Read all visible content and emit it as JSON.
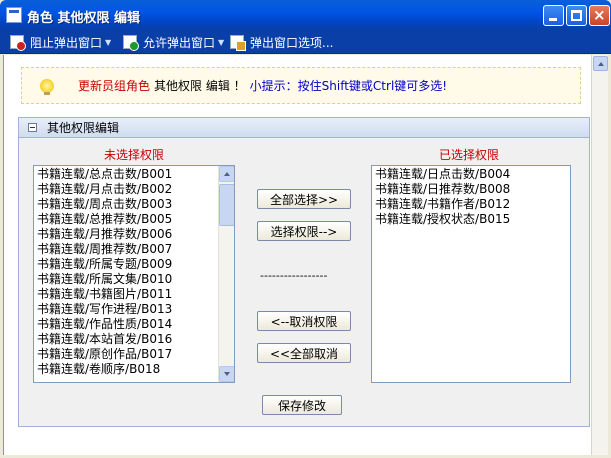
{
  "window": {
    "title": "角色 其他权限 编辑"
  },
  "toolbar": {
    "block_popup": "阻止弹出窗口",
    "allow_popup": "允许弹出窗口",
    "popup_options": "弹出窗口选项..."
  },
  "tip": {
    "role": "更新员组角色",
    "middle": "其他权限 编辑 ！",
    "hint": "小提示：按住Shift键或Ctrl键可多选!"
  },
  "panel": {
    "title": "其他权限编辑",
    "unselected_label": "未选择权限",
    "selected_label": "已选择权限"
  },
  "unselected": [
    "书籍连载/总点击数/B001",
    "书籍连载/月点击数/B002",
    "书籍连载/周点击数/B003",
    "书籍连载/总推荐数/B005",
    "书籍连载/月推荐数/B006",
    "书籍连载/周推荐数/B007",
    "书籍连载/所属专题/B009",
    "书籍连载/所属文集/B010",
    "书籍连载/书籍图片/B011",
    "书籍连载/写作进程/B013",
    "书籍连载/作品性质/B014",
    "书籍连载/本站首发/B016",
    "书籍连载/原创作品/B017",
    "书籍连载/卷顺序/B018"
  ],
  "selected": [
    "书籍连载/日点击数/B004",
    "书籍连载/日推荐数/B008",
    "书籍连载/书籍作者/B012",
    "书籍连载/授权状态/B015"
  ],
  "buttons": {
    "select_all": "全部选择>>",
    "select": "选择权限-->",
    "separator": "-----------------",
    "unselect": "<--取消权限",
    "unselect_all": "<<全部取消",
    "save": "保存修改"
  }
}
